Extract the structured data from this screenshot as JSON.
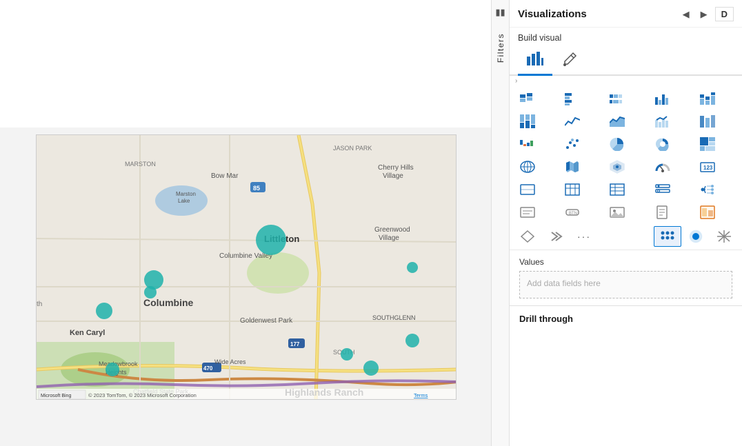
{
  "header": {
    "panel_title": "Visualizations",
    "build_visual_label": "Build visual",
    "arrow_left": "◀",
    "arrow_right": "▶",
    "data_icon": "D"
  },
  "filters": {
    "label": "Filters"
  },
  "visual_types": {
    "icons": [
      {
        "name": "stacked-bar-chart",
        "symbol": "▤",
        "active": false
      },
      {
        "name": "clustered-bar-chart",
        "symbol": "⫶",
        "active": false
      },
      {
        "name": "stacked-bar-100",
        "symbol": "▥",
        "active": false
      },
      {
        "name": "clustered-column",
        "symbol": "▦",
        "active": false
      },
      {
        "name": "stacked-column",
        "symbol": "▧",
        "active": false
      },
      {
        "name": "stacked-column-100",
        "symbol": "▩",
        "active": false
      },
      {
        "name": "line-chart",
        "symbol": "∿",
        "active": false
      },
      {
        "name": "area-chart",
        "symbol": "▲",
        "active": false
      },
      {
        "name": "line-stacked",
        "symbol": "≋",
        "active": false
      },
      {
        "name": "ribbon-chart",
        "symbol": "⋈",
        "active": false
      },
      {
        "name": "waterfall",
        "symbol": "⊟",
        "active": false
      },
      {
        "name": "scatter",
        "symbol": "⣿",
        "active": false
      },
      {
        "name": "pie-chart",
        "symbol": "◔",
        "active": false
      },
      {
        "name": "donut-chart",
        "symbol": "◎",
        "active": false
      },
      {
        "name": "treemap",
        "symbol": "⊞",
        "active": false
      },
      {
        "name": "map",
        "symbol": "🌐",
        "active": false
      },
      {
        "name": "filled-map",
        "symbol": "🗺",
        "active": false
      },
      {
        "name": "azure-map",
        "symbol": "▲",
        "active": false
      },
      {
        "name": "card-number",
        "symbol": "📊",
        "active": false
      },
      {
        "name": "multi-row-card",
        "symbol": "☰",
        "active": false
      },
      {
        "name": "gauge",
        "symbol": "◑",
        "active": false
      },
      {
        "name": "kpi",
        "symbol": "📈",
        "active": false
      },
      {
        "name": "table",
        "symbol": "⊞",
        "active": false
      },
      {
        "name": "matrix",
        "symbol": "⊟",
        "active": false
      },
      {
        "name": "slicer",
        "symbol": "≡",
        "active": false
      },
      {
        "name": "decomp-tree",
        "symbol": "⋔",
        "active": false
      },
      {
        "name": "text-box",
        "symbol": "T",
        "active": false
      },
      {
        "name": "button",
        "symbol": "⬜",
        "active": false
      },
      {
        "name": "image",
        "symbol": "🖼",
        "active": false
      },
      {
        "name": "shape",
        "symbol": "◈",
        "active": false
      },
      {
        "name": "qa-visual",
        "symbol": "❓",
        "active": false
      },
      {
        "name": "smart-narrative",
        "symbol": "✦",
        "active": false
      },
      {
        "name": "paginated-report",
        "symbol": "📄",
        "active": false
      },
      {
        "name": "key-influencers",
        "symbol": "🏆",
        "active": false
      },
      {
        "name": "bar-chart-2",
        "symbol": "📊",
        "active": false
      },
      {
        "name": "custom1",
        "symbol": "⬡",
        "active": false
      },
      {
        "name": "dots-grid",
        "symbol": "⠿",
        "active": true
      },
      {
        "name": "circle-icon",
        "symbol": "●",
        "active": false
      },
      {
        "name": "star-icon",
        "symbol": "✦",
        "active": false
      },
      {
        "name": "more",
        "symbol": "···",
        "active": false
      }
    ],
    "row2": [
      {
        "name": "dots-grid-2",
        "symbol": "⠿"
      },
      {
        "name": "circle-filled",
        "symbol": "●"
      },
      {
        "name": "asterisk",
        "symbol": "✦"
      }
    ]
  },
  "values_section": {
    "label": "Values",
    "placeholder": "Add data fields here"
  },
  "drill_through": {
    "label": "Drill through"
  },
  "map": {
    "copyright": "© 2023 TomTom, © 2023 Microsoft Corporation",
    "terms": "Terms",
    "bing_logo": "Microsoft Bing",
    "places": [
      "Littleton",
      "Columbine Valley",
      "Columbine",
      "Goldenwest Park",
      "Ken Caryl",
      "Meadowbrook Heights",
      "Wide Acres",
      "Highlands Ranch",
      "SOUTHGLENN",
      "SOUTH",
      "MARSTON",
      "Bow Mar",
      "Greenwood Village",
      "Cherry Hills Village",
      "JASON PARK",
      "Marston Lake",
      "Chatfield State Park"
    ]
  }
}
